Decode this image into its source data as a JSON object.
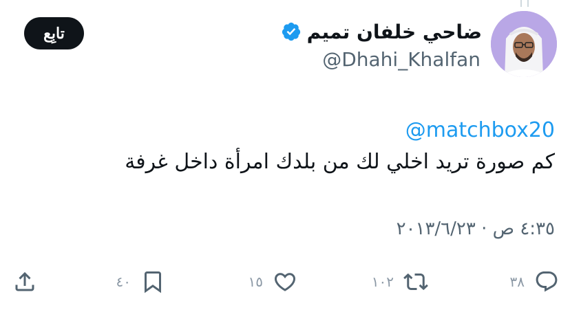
{
  "author": {
    "display_name": "ضاحي خلفان تميم",
    "handle": "@Dhahi_Khalfan",
    "verified": true
  },
  "follow_button": {
    "label": "تابِع"
  },
  "tweet": {
    "mention": "@matchbox20",
    "text": "كم صورة تريد اخلي لك من بلدك امرأة داخل غرفة",
    "timestamp": "٤:٣٥ ص · ٢٠١٣/٦/٢٣"
  },
  "actions": {
    "reply": {
      "icon": "reply-icon",
      "count": "٣٨"
    },
    "retweet": {
      "icon": "retweet-icon",
      "count": "١٠٢"
    },
    "like": {
      "icon": "heart-icon",
      "count": "١٥"
    },
    "bookmark": {
      "icon": "bookmark-icon",
      "count": "٤٠"
    },
    "share": {
      "icon": "share-icon"
    }
  },
  "colors": {
    "accent": "#1d9bf0",
    "text_primary": "#0f1419",
    "text_secondary": "#536471",
    "button_bg": "#0f1419",
    "avatar_bg": "#b9a7e6"
  }
}
